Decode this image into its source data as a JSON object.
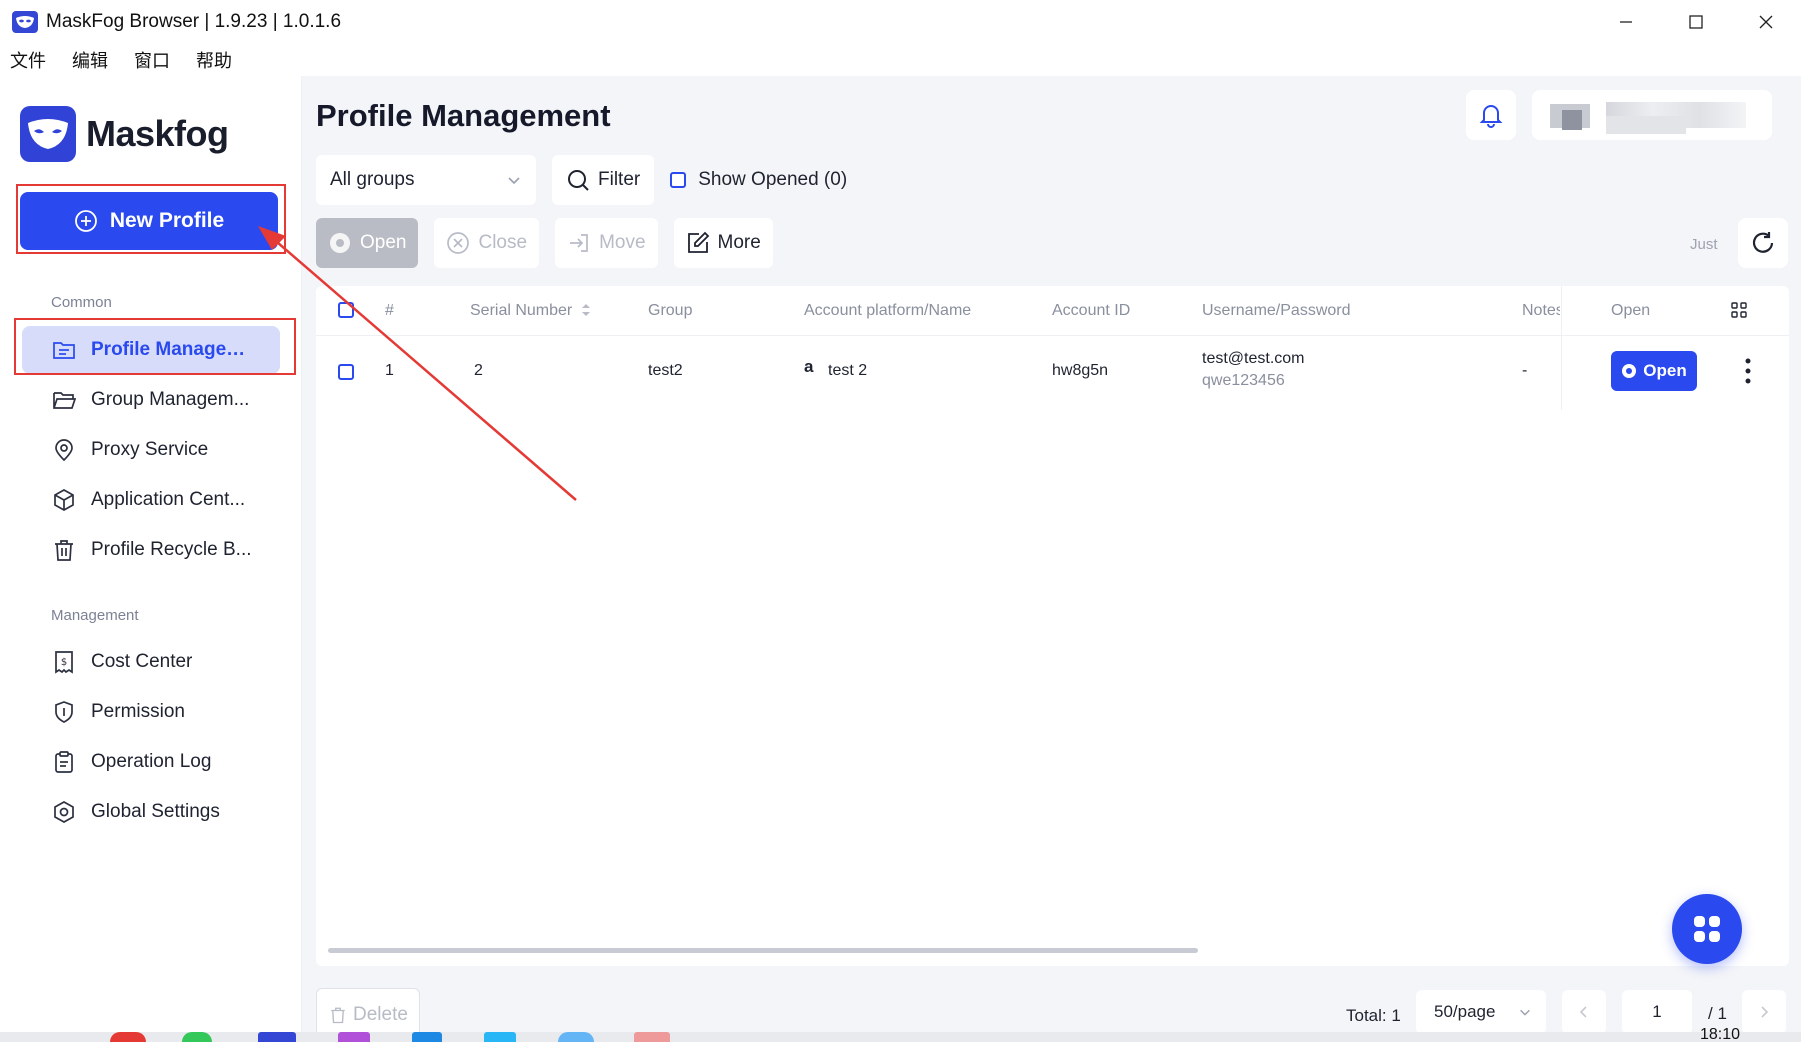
{
  "window": {
    "title": "MaskFog Browser | 1.9.23 | 1.0.1.6",
    "controls": [
      "minimize-icon",
      "maximize-icon",
      "close-icon"
    ]
  },
  "menu": {
    "items": [
      "文件",
      "编辑",
      "窗口",
      "帮助"
    ]
  },
  "sidebar": {
    "brand": "Maskfog",
    "new_profile_label": "New Profile",
    "sections": [
      {
        "label": "Common",
        "items": [
          {
            "label": "Profile Managem...",
            "icon": "folder-list-icon",
            "active": true
          },
          {
            "label": "Group Managem...",
            "icon": "folder-open-icon",
            "active": false
          },
          {
            "label": "Proxy Service",
            "icon": "location-pin-icon",
            "active": false
          },
          {
            "label": "Application Cent...",
            "icon": "cube-icon",
            "active": false
          },
          {
            "label": "Profile Recycle B...",
            "icon": "trash-icon",
            "active": false
          }
        ]
      },
      {
        "label": "Management",
        "items": [
          {
            "label": "Cost Center",
            "icon": "receipt-icon",
            "active": false
          },
          {
            "label": "Permission",
            "icon": "shield-icon",
            "active": false
          },
          {
            "label": "Operation Log",
            "icon": "clipboard-icon",
            "active": false
          },
          {
            "label": "Global Settings",
            "icon": "hexagon-gear-icon",
            "active": false
          }
        ]
      }
    ]
  },
  "main": {
    "title": "Profile Management",
    "filters": {
      "group_select": "All groups",
      "filter_label": "Filter",
      "show_opened_label": "Show Opened (0)"
    },
    "actions": {
      "open": "Open",
      "close": "Close",
      "move": "Move",
      "more": "More",
      "just": "Just"
    },
    "table": {
      "columns": [
        "#",
        "Serial Number",
        "Group",
        "Account platform/Name",
        "Account ID",
        "Username/Password",
        "Notes",
        "Open"
      ],
      "rows": [
        {
          "index": "1",
          "serial": "2",
          "group": "test2",
          "platform_icon": "a",
          "platform_name": "test 2",
          "account_id": "hw8g5n",
          "username": "test@test.com",
          "password": "qwe123456",
          "notes": "-",
          "open_label": "Open"
        }
      ]
    },
    "footer": {
      "delete_label": "Delete",
      "total": "Total: 1",
      "page_size": "50/page",
      "current_page": "1",
      "total_pages": "/ 1"
    }
  },
  "taskbar": {
    "clock": "18:10"
  },
  "colors": {
    "accent": "#2a49ee",
    "annotation": "#e53935",
    "sidebar_active_bg": "#d6dcfa",
    "main_bg": "#f4f5f8"
  }
}
